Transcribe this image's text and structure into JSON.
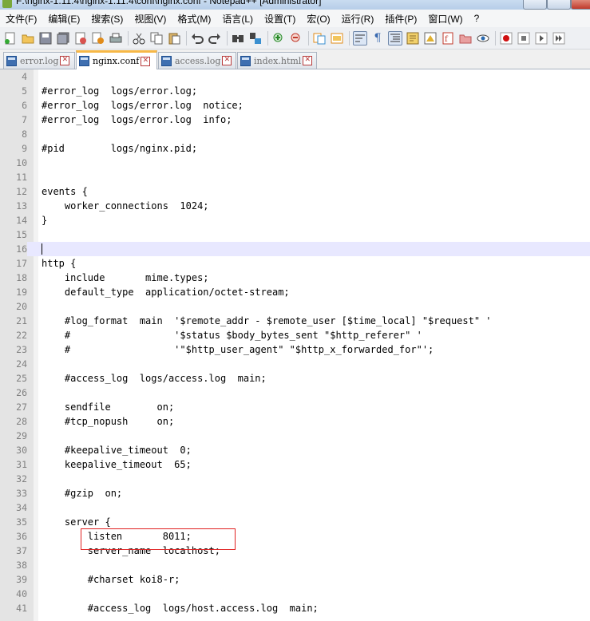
{
  "window": {
    "title": "F:\\nginx-1.11.4\\nginx-1.11.4\\conf\\nginx.conf - Notepad++ [Administrator]"
  },
  "menu": [
    "文件(F)",
    "编辑(E)",
    "搜索(S)",
    "视图(V)",
    "格式(M)",
    "语言(L)",
    "设置(T)",
    "宏(O)",
    "运行(R)",
    "插件(P)",
    "窗口(W)",
    "?"
  ],
  "toolbar": {
    "icons": [
      "new-file-icon",
      "open-file-icon",
      "save-icon",
      "save-all-icon",
      "close-icon",
      "close-all-icon",
      "print-icon",
      "cut-icon",
      "copy-icon",
      "paste-icon",
      "undo-icon",
      "redo-icon",
      "find-icon",
      "replace-icon",
      "zoom-in-icon",
      "zoom-out-icon",
      "sync-scroll-icon",
      "sync-horizontal-icon",
      "word-wrap-icon",
      "show-all-chars-icon",
      "indent-guide-icon",
      "user-language-icon",
      "doc-map-icon",
      "function-list-icon",
      "folder-workspace-icon",
      "monitor-icon",
      "record-macro-icon",
      "stop-record-icon",
      "play-macro-icon",
      "play-multiple-icon"
    ]
  },
  "tabs": [
    {
      "label": "error.log",
      "active": false
    },
    {
      "label": "nginx.conf",
      "active": true
    },
    {
      "label": "access.log",
      "active": false
    },
    {
      "label": "index.html",
      "active": false
    }
  ],
  "editor": {
    "current_line": 16,
    "lines": [
      {
        "n": "4",
        "text": ""
      },
      {
        "n": "5",
        "text": "#error_log  logs/error.log;"
      },
      {
        "n": "6",
        "text": "#error_log  logs/error.log  notice;"
      },
      {
        "n": "7",
        "text": "#error_log  logs/error.log  info;"
      },
      {
        "n": "8",
        "text": ""
      },
      {
        "n": "9",
        "text": "#pid        logs/nginx.pid;"
      },
      {
        "n": "10",
        "text": ""
      },
      {
        "n": "11",
        "text": ""
      },
      {
        "n": "12",
        "text": "events {"
      },
      {
        "n": "13",
        "text": "    worker_connections  1024;"
      },
      {
        "n": "14",
        "text": "}"
      },
      {
        "n": "15",
        "text": ""
      },
      {
        "n": "16",
        "text": ""
      },
      {
        "n": "17",
        "text": "http {"
      },
      {
        "n": "18",
        "text": "    include       mime.types;"
      },
      {
        "n": "19",
        "text": "    default_type  application/octet-stream;"
      },
      {
        "n": "20",
        "text": ""
      },
      {
        "n": "21",
        "text": "    #log_format  main  '$remote_addr - $remote_user [$time_local] \"$request\" '"
      },
      {
        "n": "22",
        "text": "    #                  '$status $body_bytes_sent \"$http_referer\" '"
      },
      {
        "n": "23",
        "text": "    #                  '\"$http_user_agent\" \"$http_x_forwarded_for\"';"
      },
      {
        "n": "24",
        "text": ""
      },
      {
        "n": "25",
        "text": "    #access_log  logs/access.log  main;"
      },
      {
        "n": "26",
        "text": ""
      },
      {
        "n": "27",
        "text": "    sendfile        on;"
      },
      {
        "n": "28",
        "text": "    #tcp_nopush     on;"
      },
      {
        "n": "29",
        "text": ""
      },
      {
        "n": "30",
        "text": "    #keepalive_timeout  0;"
      },
      {
        "n": "31",
        "text": "    keepalive_timeout  65;"
      },
      {
        "n": "32",
        "text": ""
      },
      {
        "n": "33",
        "text": "    #gzip  on;"
      },
      {
        "n": "34",
        "text": ""
      },
      {
        "n": "35",
        "text": "    server {"
      },
      {
        "n": "36",
        "text": "        listen       8011;"
      },
      {
        "n": "37",
        "text": "        server_name  localhost;"
      },
      {
        "n": "38",
        "text": ""
      },
      {
        "n": "39",
        "text": "        #charset koi8-r;"
      },
      {
        "n": "40",
        "text": ""
      },
      {
        "n": "41",
        "text": "        #access_log  logs/host.access.log  main;"
      }
    ]
  },
  "annotation": {
    "highlighted_line": 36,
    "color": "#e02020"
  }
}
